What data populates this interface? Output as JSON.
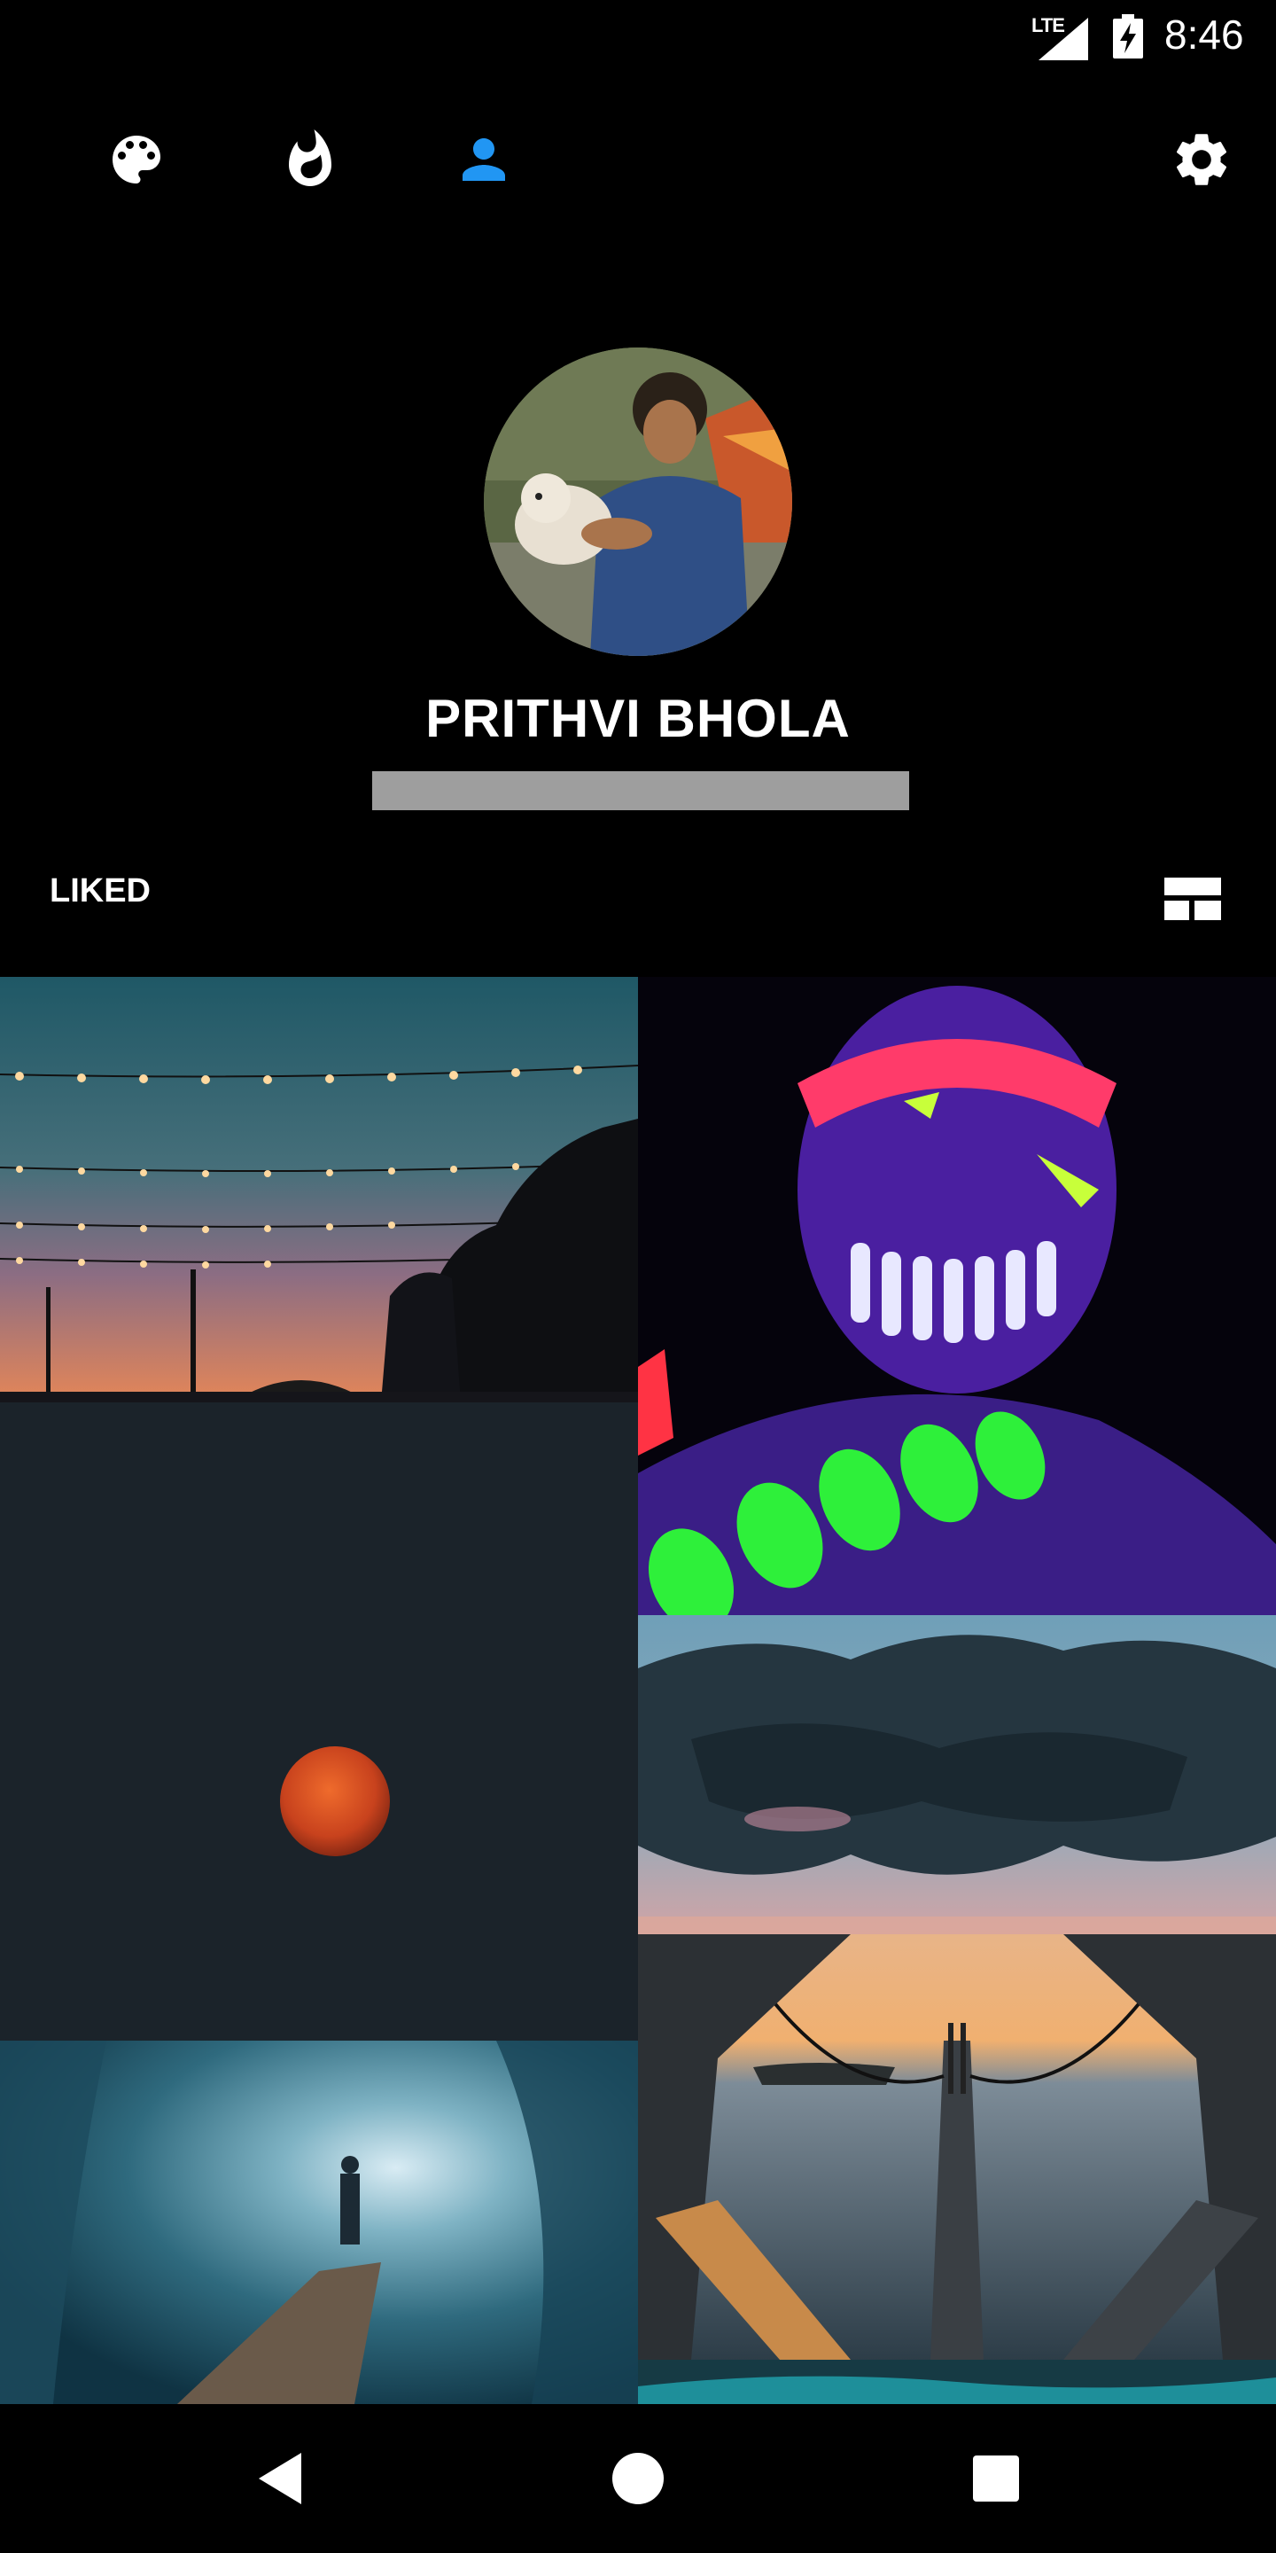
{
  "status_bar": {
    "network": "LTE",
    "time": "8:46"
  },
  "top_nav": {
    "items": [
      {
        "icon": "palette-icon"
      },
      {
        "icon": "flame-icon"
      },
      {
        "icon": "person-icon",
        "active": true
      }
    ],
    "settings_icon": "gear-icon",
    "active_color": "#2196f3"
  },
  "profile": {
    "name": "PRITHVI BHOLA"
  },
  "liked": {
    "label": "LIKED",
    "layout_icon": "grid-view-icon"
  },
  "photos": [
    {
      "subject": "string lights at dusk with pier sign"
    },
    {
      "subject": "neon body paint portrait"
    },
    {
      "subject": "orange planet on dark slate"
    },
    {
      "subject": "storm clouds at sunset"
    },
    {
      "subject": "ice cave with walkway"
    },
    {
      "subject": "bridge seen through octagonal frame"
    },
    {
      "subject": "teal water"
    }
  ],
  "system_nav": {
    "back": "back-icon",
    "home": "home-icon",
    "recents": "recents-icon"
  }
}
